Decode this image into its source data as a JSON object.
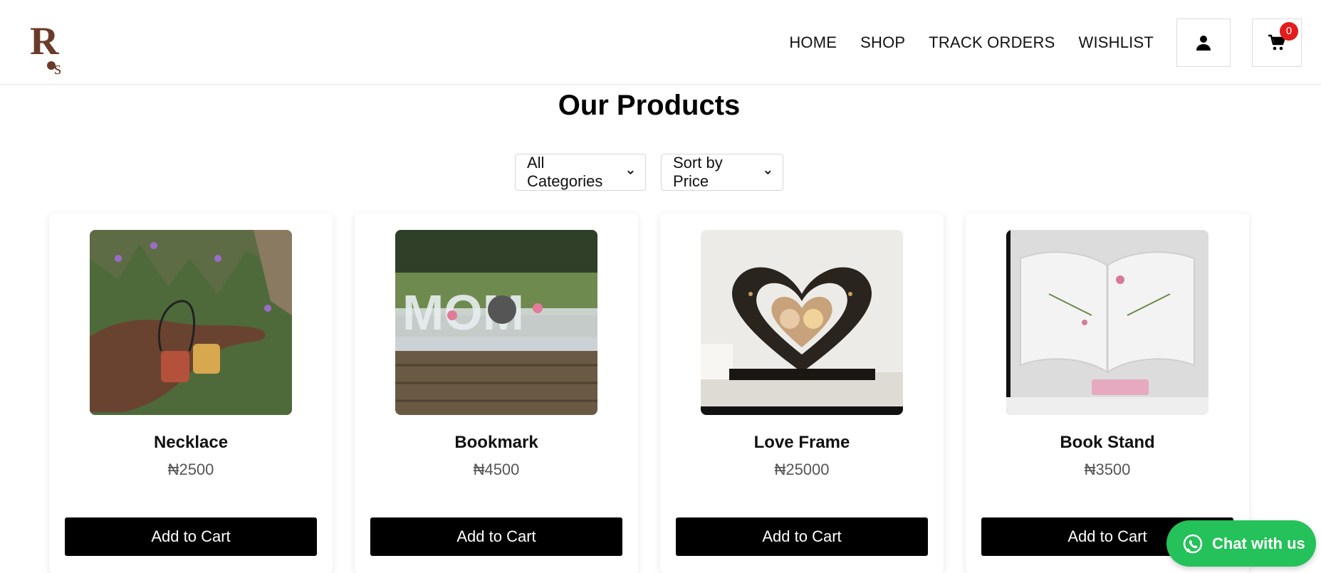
{
  "brand": {
    "logo_text": "Ros"
  },
  "nav": {
    "items": [
      "HOME",
      "SHOP",
      "TRACK ORDERS",
      "WISHLIST"
    ],
    "cart_count": "0"
  },
  "page": {
    "title": "Our Products"
  },
  "filters": {
    "category": "All Categories",
    "sort": "Sort by Price"
  },
  "products": [
    {
      "name": "Necklace",
      "price": "₦2500",
      "button": "Add to Cart"
    },
    {
      "name": "Bookmark",
      "price": "₦4500",
      "button": "Add to Cart"
    },
    {
      "name": "Love Frame",
      "price": "₦25000",
      "button": "Add to Cart"
    },
    {
      "name": "Book Stand",
      "price": "₦3500",
      "button": "Add to Cart"
    }
  ],
  "chat": {
    "label": "Chat with us"
  },
  "colors": {
    "brand": "#6b3b2a",
    "button": "#000000",
    "badge": "#e11d1d",
    "whatsapp": "#25c15a"
  }
}
